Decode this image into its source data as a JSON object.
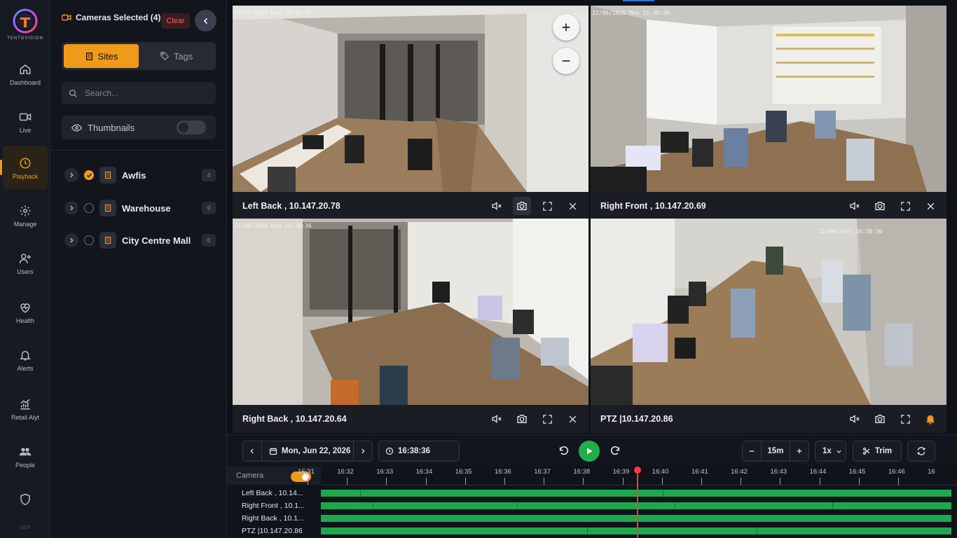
{
  "brand": {
    "name": "TENTOVISION",
    "accent": "#f09a1a"
  },
  "nav": [
    {
      "label": "Dashboard",
      "icon": "home-icon"
    },
    {
      "label": "Live",
      "icon": "video-icon"
    },
    {
      "label": "Playback",
      "icon": "clock-icon",
      "active": true
    },
    {
      "label": "Manage",
      "icon": "gear-icon"
    },
    {
      "label": "Users",
      "icon": "users-gear-icon"
    },
    {
      "label": "Health",
      "icon": "heart-pulse-icon"
    },
    {
      "label": "Alerts",
      "icon": "bell-icon"
    },
    {
      "label": "Retail Alyt",
      "icon": "chart-icon"
    },
    {
      "label": "People",
      "icon": "people-icon"
    },
    {
      "label": "",
      "icon": "shield-icon"
    }
  ],
  "version": "v2.0",
  "panel": {
    "cameras_selected": "Cameras Selected (4)",
    "clear": "Clear",
    "tabs": {
      "sites": "Sites",
      "tags": "Tags"
    },
    "search_placeholder": "Search...",
    "thumbnails": "Thumbnails",
    "sites": [
      {
        "name": "Awfis",
        "count": "4",
        "checked": true
      },
      {
        "name": "Warehouse",
        "count": "9",
        "checked": false
      },
      {
        "name": "City Centre Mall",
        "count": "6",
        "checked": false
      }
    ]
  },
  "cameras": [
    {
      "label": "Left Back , 10.147.20.78",
      "osd": "22/06/2026 Mon 16:38:36"
    },
    {
      "label": "Right Front , 10.147.20.69",
      "osd": "22/06/2026 Mon 16:38:36"
    },
    {
      "label": "Right Back , 10.147.20.64",
      "osd": "22/06/2026 Mon 16:38:36"
    },
    {
      "label": "PTZ |10.147.20.86",
      "osd": "22/06/2026 16:38:36"
    }
  ],
  "controls": {
    "date": "Mon, Jun 22, 2026",
    "time": "16:38:36",
    "zoom_window": "15m",
    "speed": "1x",
    "trim": "Trim"
  },
  "timeline": {
    "camera_label": "Camera",
    "ticks": [
      "16:31",
      "16:32",
      "16:33",
      "16:34",
      "16:35",
      "16:36",
      "16:37",
      "16:38",
      "16:39",
      "16:40",
      "16:41",
      "16:42",
      "16:43",
      "16:44",
      "16:45",
      "16:46",
      "16"
    ],
    "rows": [
      "Left Back , 10.14...",
      "Right Front , 10.1...",
      "Right Back , 10.1...",
      "PTZ |10.147.20.86"
    ],
    "playhead": "16:38:36"
  }
}
